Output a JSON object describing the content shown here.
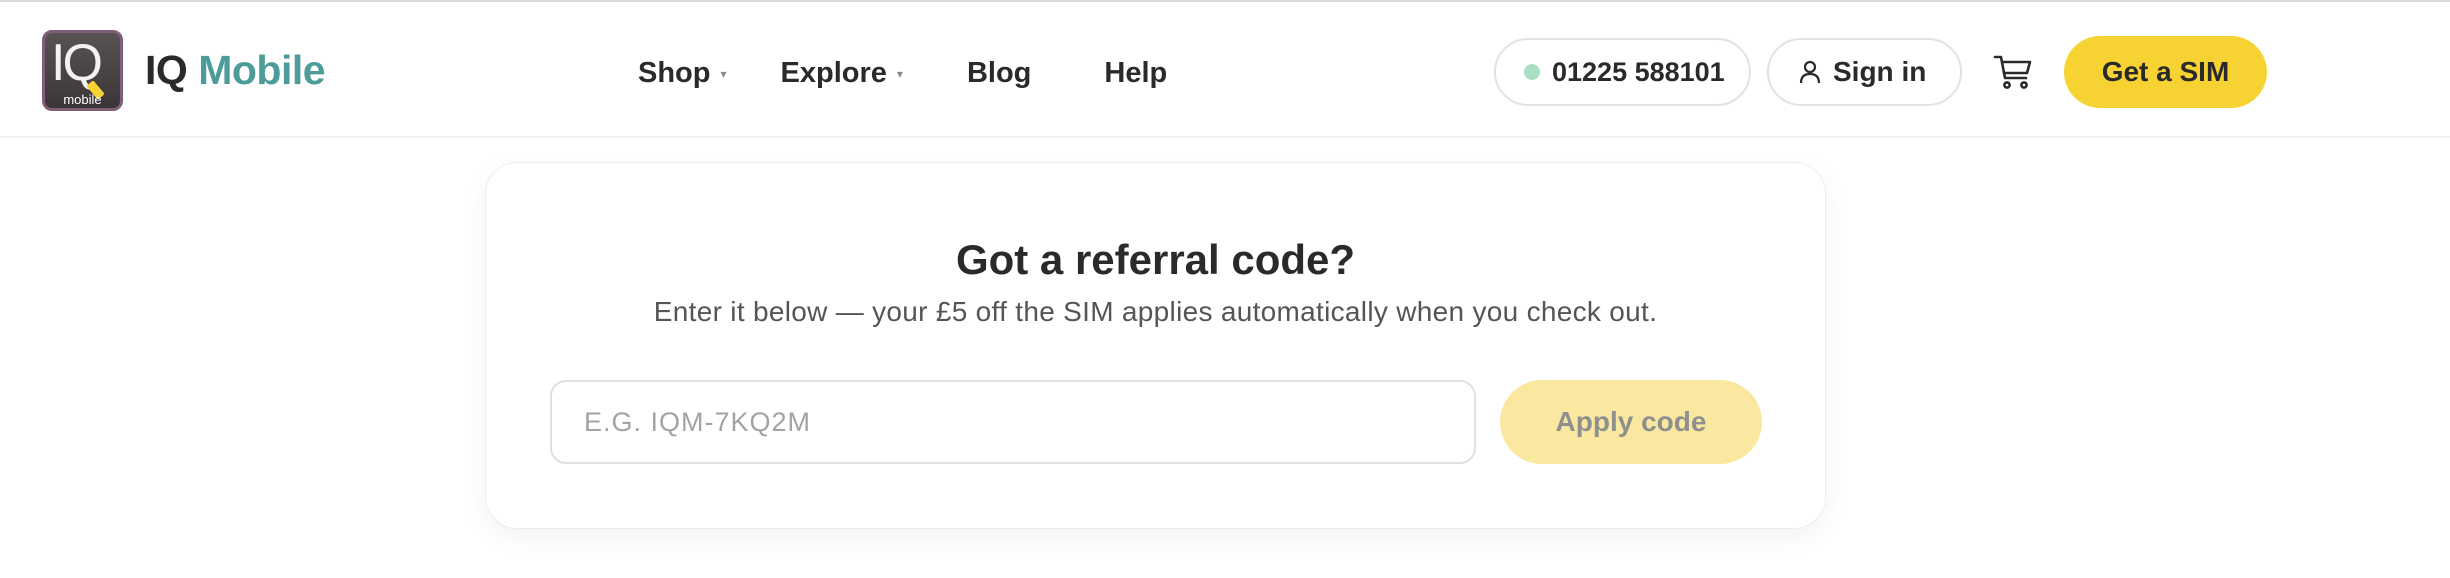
{
  "brand": {
    "mark_letters": "IQ",
    "mark_small": "mobile",
    "name_part1": "IQ",
    "name_part2": "Mobile",
    "accent_color": "#4d9c9a"
  },
  "nav": {
    "items": [
      {
        "label": "Shop",
        "has_dropdown": true
      },
      {
        "label": "Explore",
        "has_dropdown": true
      },
      {
        "label": "Blog",
        "has_dropdown": false
      },
      {
        "label": "Help",
        "has_dropdown": false
      }
    ],
    "caret": "▾"
  },
  "header": {
    "phone": "01225 588101",
    "phone_status_color": "#a7e0c2",
    "signin_label": "Sign in",
    "signin_icon": "user-icon",
    "cart_icon": "cart-icon",
    "cta_label": "Get a SIM",
    "cta_color": "#f6d232"
  },
  "referral": {
    "title": "Got a referral code?",
    "subtitle": "Enter it below — your £5 off the SIM applies automatically when you check out.",
    "input_value": "",
    "input_placeholder": "E.G. IQM-7KQ2M",
    "apply_label": "Apply code",
    "apply_disabled": true
  }
}
